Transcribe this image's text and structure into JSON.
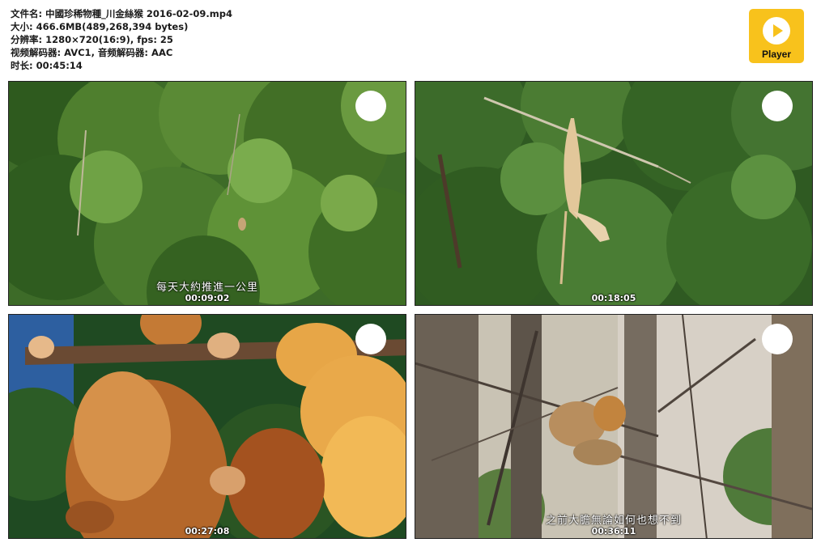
{
  "info": {
    "filename_line": "文件名: 中國珍稀物種_川金絲猴 2016-02-09.mp4",
    "size_line": "大小: 466.6MB(489,268,394 bytes)",
    "resolution_line": "分辨率: 1280×720(16:9), fps: 25",
    "codec_line": "视频解码器: AVC1, 音频解码器: AAC",
    "duration_line": "时长: 00:45:14"
  },
  "player_logo": {
    "label": "Player",
    "color": "#f8c21c",
    "icon": "play-icon"
  },
  "thumbnails": [
    {
      "timestamp": "00:09:02",
      "subtitle": "每天大約推進一公里"
    },
    {
      "timestamp": "00:18:05",
      "subtitle": ""
    },
    {
      "timestamp": "00:27:08",
      "subtitle": ""
    },
    {
      "timestamp": "00:36:11",
      "subtitle": "之前大膽無論如何也想不到"
    }
  ]
}
